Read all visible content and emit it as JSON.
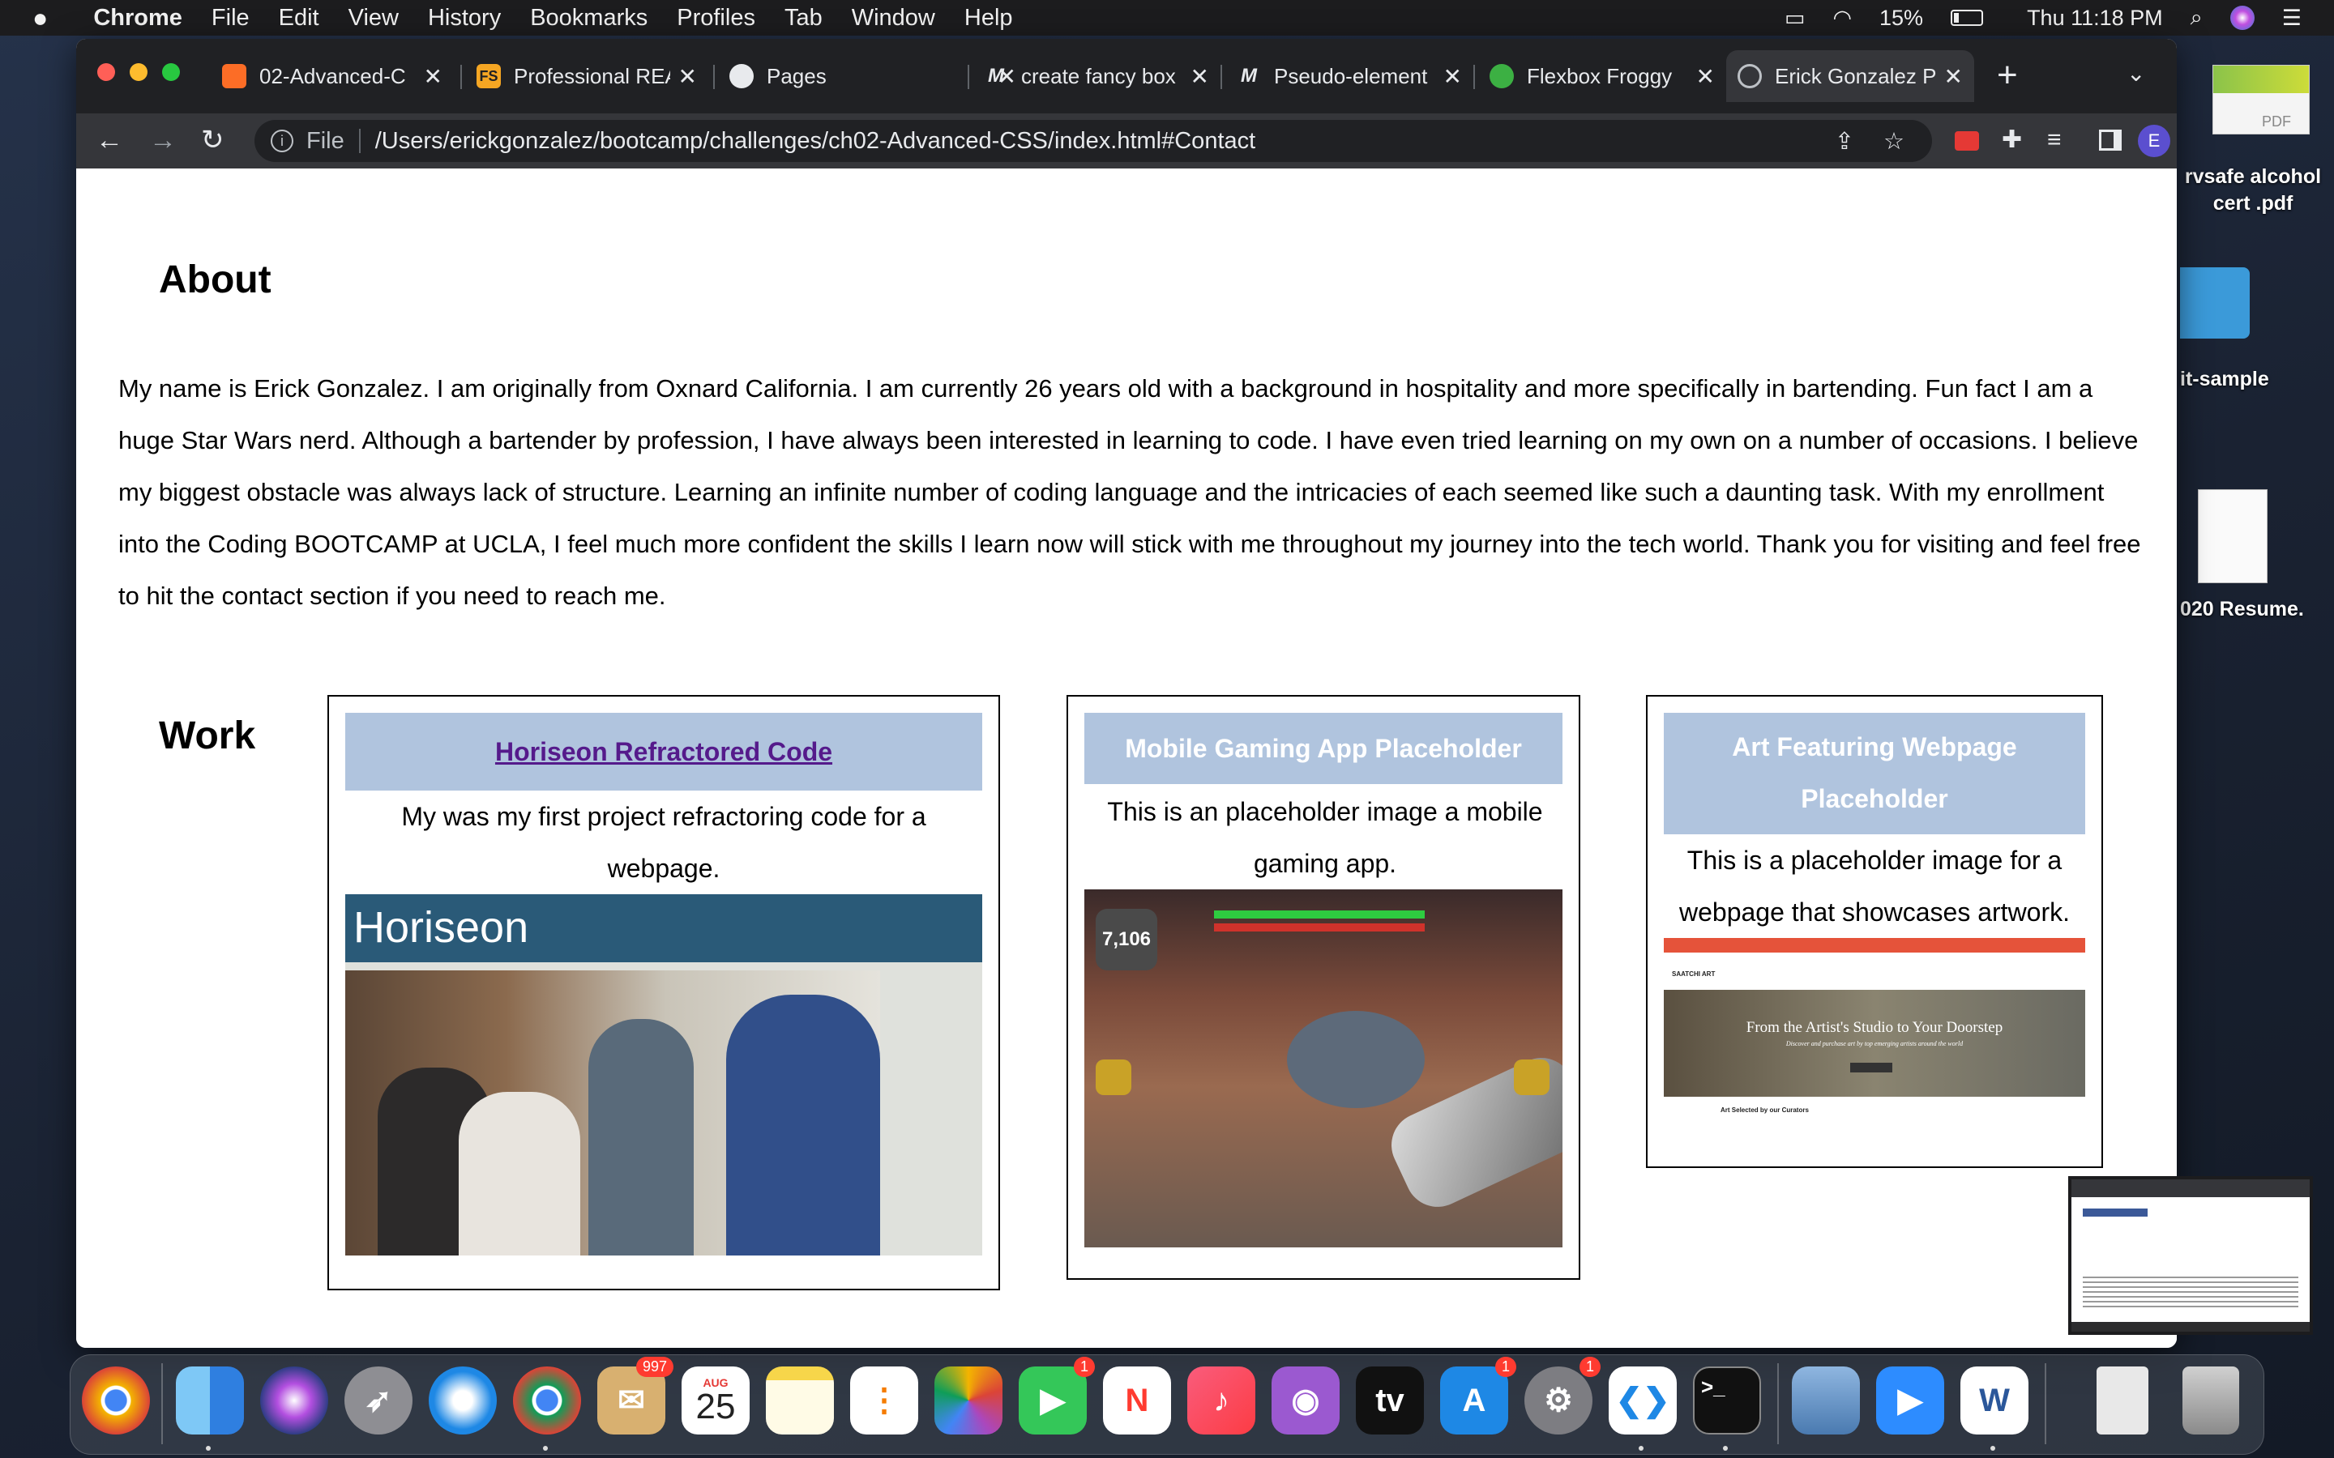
{
  "menubar": {
    "apple": "",
    "app_name": "Chrome",
    "items": [
      "File",
      "Edit",
      "View",
      "History",
      "Bookmarks",
      "Profiles",
      "Tab",
      "Window",
      "Help"
    ],
    "battery": "15%",
    "clock": "Thu 11:18 PM"
  },
  "desktop": {
    "icons": [
      {
        "label": "rvsafe alcohol cert .pdf",
        "kind": "pdf",
        "badge": "PDF"
      },
      {
        "label": "it-sample",
        "kind": "folder"
      },
      {
        "label": "020 Resume.",
        "kind": "document"
      }
    ]
  },
  "browser": {
    "tabs": [
      {
        "title": "02-Advanced-C",
        "icon": "gitlab-icon",
        "active": false
      },
      {
        "title": "Professional REA",
        "icon": "fs-icon",
        "fav_text": "FS",
        "active": false
      },
      {
        "title": "Pages",
        "icon": "github-icon",
        "active": false
      },
      {
        "title": "create fancy box",
        "icon": "medium-icon",
        "fav_text": "M",
        "active": false
      },
      {
        "title": "Pseudo-element",
        "icon": "medium-icon",
        "fav_text": "M",
        "active": false
      },
      {
        "title": "Flexbox Froggy",
        "icon": "frog-icon",
        "active": false
      },
      {
        "title": "Erick Gonzalez P",
        "icon": "globe-icon",
        "active": true
      }
    ],
    "new_tab": "+",
    "address": {
      "scheme_label": "File",
      "url": "/Users/erickgonzalez/bootcamp/challenges/ch02-Advanced-CSS/index.html#Contact"
    },
    "profile_initial": "E"
  },
  "page": {
    "about": {
      "heading": "About",
      "text": "My name is Erick Gonzalez. I am originally from Oxnard California. I am currently 26 years old with a background in hospitality and more specifically in bartending. Fun fact I am a huge Star Wars nerd. Although a bartender by profession, I have always been interested in learning to code. I have even tried learning on my own on a number of occasions. I believe my biggest obstacle was always lack of structure. Learning an infinite number of coding language and the intricacies of each seemed like such a daunting task. With my enrollment into the Coding BOOTCAMP at UCLA, I feel much more confident the skills I learn now will stick with me throughout my journey into the tech world. Thank you for visiting and feel free to hit the contact section if you need to reach me."
    },
    "work": {
      "heading": "Work",
      "cards": [
        {
          "title": "Horiseon Refractored Code",
          "desc": "My was my first project refractoring code for a webpage.",
          "image_text": "Horiseon",
          "link": true
        },
        {
          "title": "Mobile Gaming App Placeholder",
          "desc": "This is an placeholder image a mobile gaming app.",
          "image_text": "7,106",
          "link": false
        },
        {
          "title": "Art Featuring Webpage Placeholder",
          "desc": "This is a placeholder image for a webpage that showcases artwork.",
          "image_text": "From the Artist's Studio to Your Doorstep",
          "image_subtext": "Discover and purchase art by top emerging artists around the world",
          "image_logo": "SAATCHI ART",
          "image_caption": "Art Selected by our Curators",
          "link": false
        }
      ]
    }
  },
  "dock": {
    "items": [
      {
        "name": "chrome-canary",
        "badge": ""
      },
      {
        "name": "finder",
        "badge": ""
      },
      {
        "name": "siri",
        "badge": ""
      },
      {
        "name": "launchpad",
        "badge": ""
      },
      {
        "name": "safari",
        "badge": ""
      },
      {
        "name": "chrome",
        "badge": ""
      },
      {
        "name": "mail",
        "badge": "997"
      },
      {
        "name": "calendar",
        "badge": "",
        "month": "AUG",
        "day": "25"
      },
      {
        "name": "notes",
        "badge": ""
      },
      {
        "name": "reminders",
        "badge": ""
      },
      {
        "name": "photos",
        "badge": ""
      },
      {
        "name": "facetime",
        "badge": "1"
      },
      {
        "name": "news",
        "badge": ""
      },
      {
        "name": "music",
        "badge": ""
      },
      {
        "name": "podcasts",
        "badge": ""
      },
      {
        "name": "tv",
        "badge": "",
        "text": "tv"
      },
      {
        "name": "app-store",
        "badge": "1"
      },
      {
        "name": "system-preferences",
        "badge": "1"
      },
      {
        "name": "vscode",
        "badge": ""
      },
      {
        "name": "terminal",
        "badge": "",
        "text": ">_"
      },
      {
        "name": "preview",
        "badge": ""
      },
      {
        "name": "zoom",
        "badge": ""
      },
      {
        "name": "word",
        "badge": "",
        "text": "W"
      },
      {
        "name": "downloads-stack",
        "badge": ""
      },
      {
        "name": "trash",
        "badge": ""
      }
    ]
  },
  "colors": {
    "card_title_bg": "#b0c4de",
    "card_title_text": "#ffffff",
    "link_color": "#551a8b",
    "chrome_dark": "#202124",
    "chrome_toolbar": "#35363a"
  }
}
